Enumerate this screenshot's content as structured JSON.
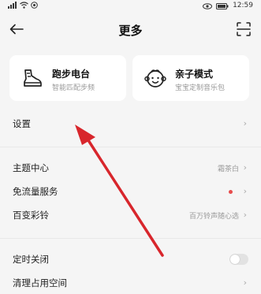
{
  "status_bar": {
    "time": "12:59",
    "battery_icon": "battery-icon",
    "signal_icon": "signal-icon",
    "wifi_icon": "wifi-icon"
  },
  "header": {
    "title": "更多",
    "back_icon": "back-arrow-icon",
    "scan_icon": "scan-icon"
  },
  "cards": [
    {
      "title": "跑步电台",
      "subtitle": "智能匹配步频",
      "icon": "running-shoe-icon"
    },
    {
      "title": "亲子模式",
      "subtitle": "宝宝定制音乐包",
      "icon": "child-face-icon"
    }
  ],
  "menu": {
    "settings": {
      "label": "设置"
    },
    "theme": {
      "label": "主题中心",
      "value": "霜茶白"
    },
    "free_data": {
      "label": "免流量服务"
    },
    "ringtone": {
      "label": "百变彩铃",
      "value": "百万铃声随心选"
    },
    "timer": {
      "label": "定时关闭"
    },
    "clean": {
      "label": "清理占用空间"
    }
  },
  "chevron_glyph": "›",
  "colors": {
    "annotation_arrow": "#d8262c",
    "badge_dot": "#e74c4c",
    "background": "#f5f5f5"
  }
}
